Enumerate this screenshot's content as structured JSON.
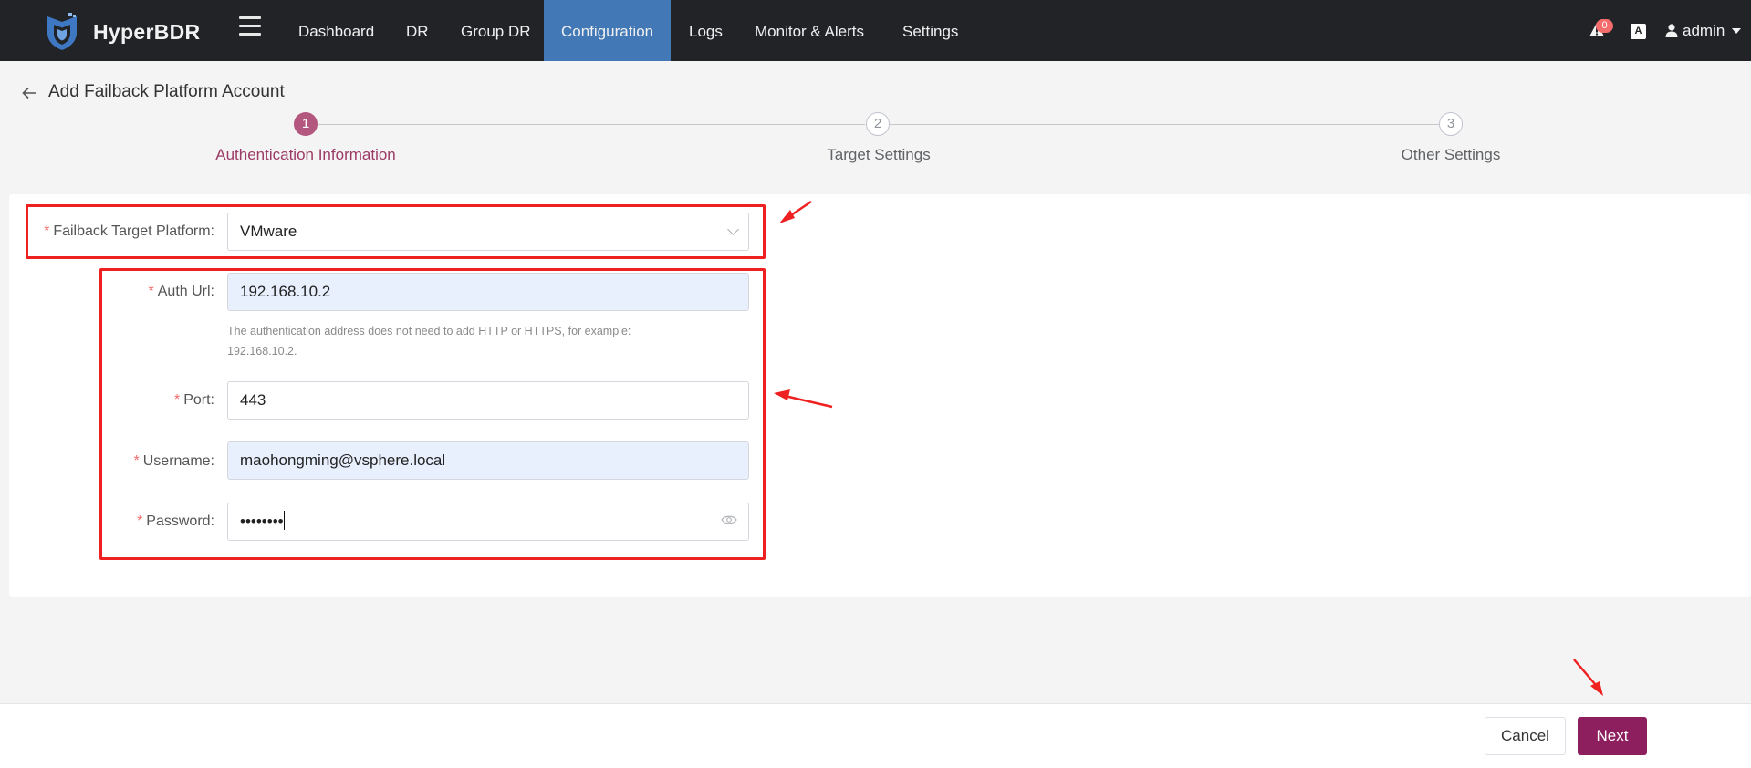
{
  "app": {
    "name": "HyperBDR"
  },
  "nav": {
    "items": [
      {
        "label": "Dashboard",
        "active": false
      },
      {
        "label": "DR",
        "active": false
      },
      {
        "label": "Group DR",
        "active": false
      },
      {
        "label": "Configuration",
        "active": true
      },
      {
        "label": "Logs",
        "active": false
      },
      {
        "label": "Monitor & Alerts",
        "active": false
      },
      {
        "label": "Settings",
        "active": false
      }
    ],
    "alert_count": "0",
    "lang_icon_text": "A",
    "user_name": "admin"
  },
  "page": {
    "title": "Add Failback Platform Account"
  },
  "steps": [
    {
      "number": "1",
      "label": "Authentication Information",
      "state": "active"
    },
    {
      "number": "2",
      "label": "Target Settings",
      "state": "todo"
    },
    {
      "number": "3",
      "label": "Other Settings",
      "state": "todo"
    }
  ],
  "form": {
    "platform": {
      "label": "Failback Target Platform:",
      "value": "VMware"
    },
    "auth_url": {
      "label": "Auth Url:",
      "value": "192.168.10.2",
      "hint_line1": "The authentication address does not need to add HTTP or HTTPS, for example:",
      "hint_line2": "192.168.10.2."
    },
    "port": {
      "label": "Port:",
      "value": "443"
    },
    "username": {
      "label": "Username:",
      "value": "maohongming@vsphere.local"
    },
    "password": {
      "label": "Password:",
      "value": "••••••••"
    }
  },
  "footer": {
    "cancel_label": "Cancel",
    "next_label": "Next"
  },
  "colors": {
    "nav_bg": "#222326",
    "nav_active": "#4178b5",
    "step_active": "#b3577f",
    "primary_button": "#8e1f5f",
    "annotation_red": "#ee2020"
  }
}
